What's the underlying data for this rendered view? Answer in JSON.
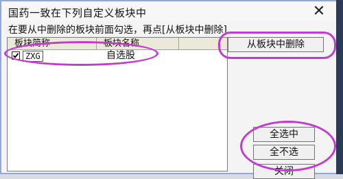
{
  "window": {
    "title": "国药一致在下列自定义板块中",
    "close_glyph": "✕"
  },
  "instruction": "在要从中删除的板块前面勾选，再点[从板块中删除]",
  "table": {
    "columns": [
      "板块简称",
      "板块名称"
    ],
    "rows": [
      {
        "checked": true,
        "code": "ZXG",
        "name": "自选股"
      }
    ]
  },
  "buttons": {
    "delete_from_block": "从板块中删除",
    "select_all": "全选中",
    "select_none": "全不选",
    "close": "关闭"
  },
  "colors": {
    "annotation": "#c23bd0",
    "window_border": "#8fa8d8"
  }
}
